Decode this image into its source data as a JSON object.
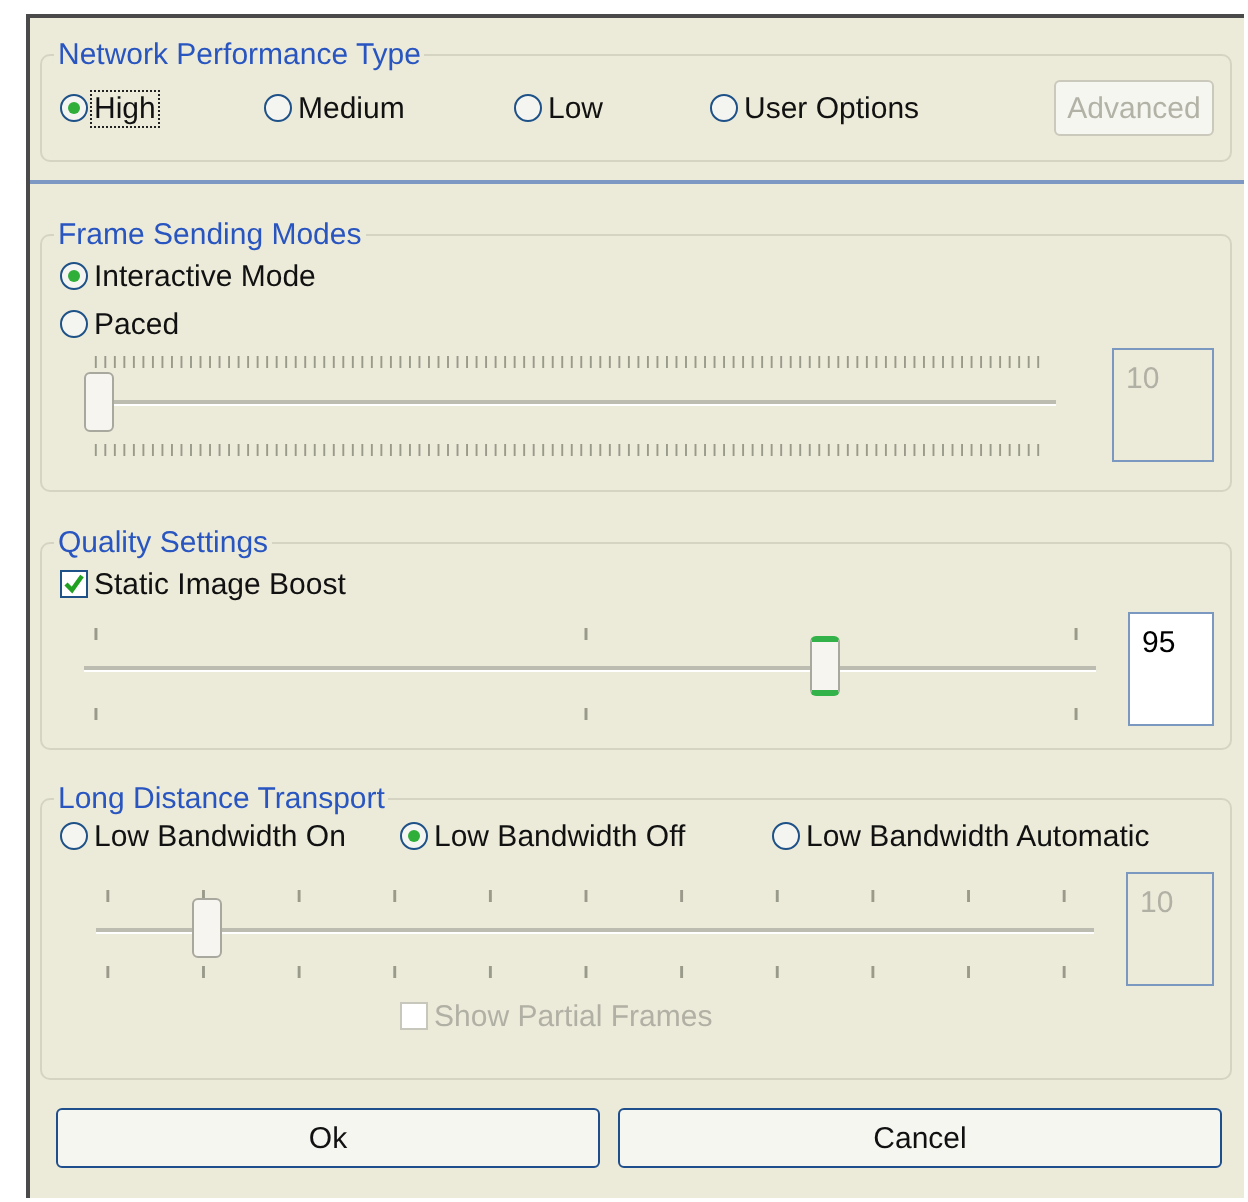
{
  "performance": {
    "title": "Network Performance Type",
    "options": [
      {
        "label": "High",
        "selected": true,
        "focused": true
      },
      {
        "label": "Medium",
        "selected": false,
        "focused": false
      },
      {
        "label": "Low",
        "selected": false,
        "focused": false
      },
      {
        "label": "User Options",
        "selected": false,
        "focused": false
      }
    ],
    "advanced_button": {
      "label": "Advanced",
      "disabled": true
    }
  },
  "frame_modes": {
    "title": "Frame Sending Modes",
    "options": [
      {
        "label": "Interactive Mode",
        "selected": true
      },
      {
        "label": "Paced",
        "selected": false
      }
    ],
    "slider": {
      "kind": "fine",
      "level": 0,
      "value": "10",
      "disabled": true
    }
  },
  "quality": {
    "title": "Quality Settings",
    "checkbox": {
      "label": "Static Image Boost",
      "checked": true,
      "disabled": false
    },
    "slider": {
      "kind": "thirds",
      "level": 0.74,
      "value": "95",
      "disabled": false
    }
  },
  "transport": {
    "title": "Long Distance Transport",
    "options": [
      {
        "label": "Low Bandwidth On",
        "selected": false
      },
      {
        "label": "Low Bandwidth Off",
        "selected": true
      },
      {
        "label": "Low Bandwidth Automatic",
        "selected": false
      }
    ],
    "slider": {
      "kind": "tenths",
      "level": 0.1,
      "value": "10",
      "disabled": true
    },
    "checkbox": {
      "label": "Show Partial Frames",
      "checked": false,
      "disabled": true
    }
  },
  "buttons": [
    {
      "label": "Ok"
    },
    {
      "label": "Cancel"
    }
  ]
}
